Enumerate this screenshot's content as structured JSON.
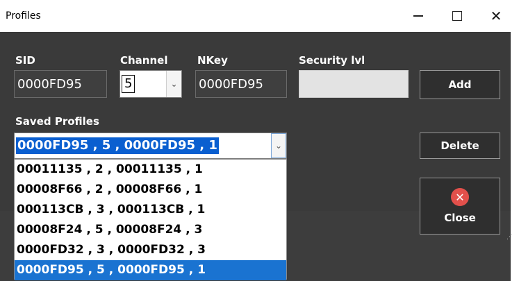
{
  "window": {
    "title": "Profiles"
  },
  "fields": {
    "sid": {
      "label": "SID",
      "value": "0000FD95"
    },
    "channel": {
      "label": "Channel",
      "value": "5"
    },
    "nkey": {
      "label": "NKey",
      "value": "0000FD95"
    },
    "security": {
      "label": "Security lvl",
      "value": ""
    }
  },
  "saved_profiles": {
    "label": "Saved Profiles",
    "selected": "0000FD95 , 5 , 0000FD95 , 1",
    "options": [
      "00011135 , 2 , 00011135 , 1",
      "00008F66 , 2 , 00008F66 , 1",
      "000113CB , 3 , 000113CB , 1",
      "00008F24 , 5 , 00008F24 , 3",
      "0000FD32 , 3 , 0000FD32 , 3",
      "0000FD95 , 5 , 0000FD95 , 1"
    ]
  },
  "buttons": {
    "add": "Add",
    "delete": "Delete",
    "close": "Close"
  },
  "icons": {
    "close": "close-circle-icon",
    "dropdown": "chevron-down-icon"
  },
  "colors": {
    "selection": "#1a73d1",
    "close_icon": "#e2504b",
    "background": "#3a3a3a"
  }
}
